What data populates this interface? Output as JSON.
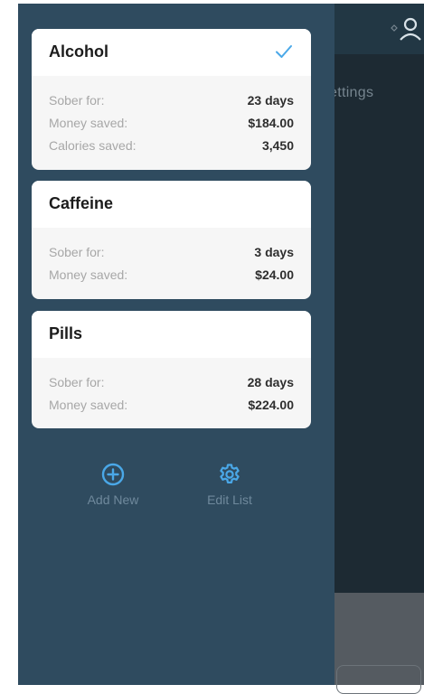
{
  "background": {
    "tab_label": "ettings",
    "profile_icon": "profile-icon"
  },
  "colors": {
    "drawer": "#2f4b5f",
    "accent": "#4aa8e8",
    "backdrop": "#1d2a33"
  },
  "items": [
    {
      "name": "Alcohol",
      "selected": true,
      "stats": [
        {
          "label": "Sober for:",
          "value": "23 days"
        },
        {
          "label": "Money saved:",
          "value": "$184.00"
        },
        {
          "label": "Calories saved:",
          "value": "3,450"
        }
      ]
    },
    {
      "name": "Caffeine",
      "selected": false,
      "stats": [
        {
          "label": "Sober for:",
          "value": "3 days"
        },
        {
          "label": "Money saved:",
          "value": "$24.00"
        }
      ]
    },
    {
      "name": "Pills",
      "selected": false,
      "stats": [
        {
          "label": "Sober for:",
          "value": "28 days"
        },
        {
          "label": "Money saved:",
          "value": "$224.00"
        }
      ]
    }
  ],
  "actions": {
    "add_new": {
      "label": "Add New",
      "icon": "plus-circle-icon"
    },
    "edit_list": {
      "label": "Edit List",
      "icon": "gear-icon"
    }
  }
}
